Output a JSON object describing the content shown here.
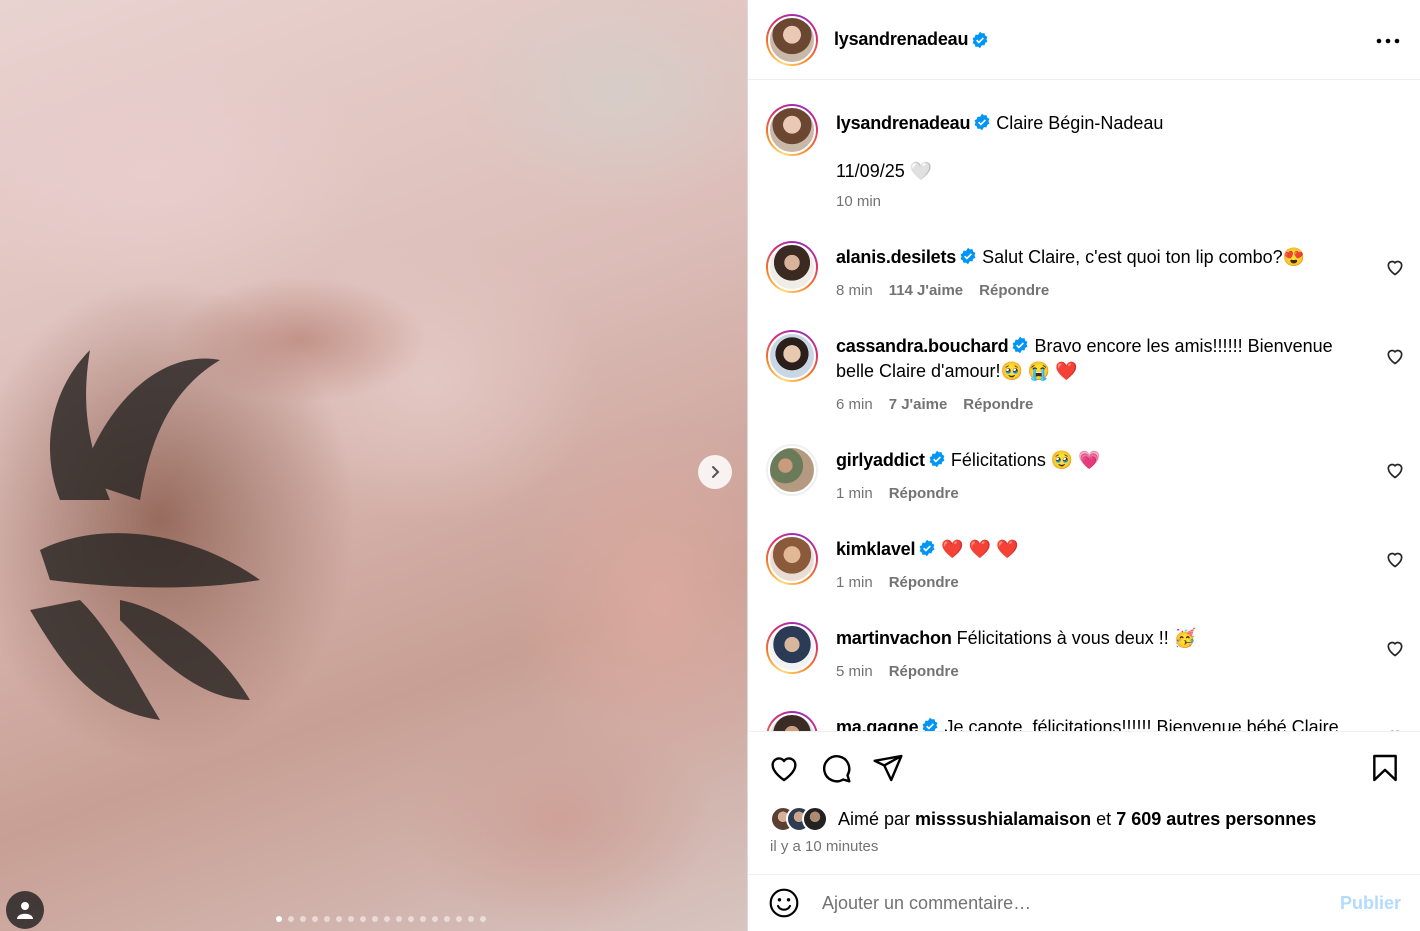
{
  "post": {
    "author": "lysandrenadeau",
    "caption_text": "Claire Bégin-Nadeau",
    "caption_date": "11/09/25 🤍",
    "caption_time": "10 min",
    "carousel_dot_count": 18,
    "carousel_active_index": 0
  },
  "comments": [
    {
      "user": "alanis.desilets",
      "verified": true,
      "text": "Salut Claire, c'est quoi ton lip combo?😍",
      "time": "8 min",
      "likes": "114 J'aime",
      "reply": "Répondre"
    },
    {
      "user": "cassandra.bouchard",
      "verified": true,
      "text": "Bravo encore les amis!!!!!! Bienvenue belle Claire d'amour!🥹 😭 ❤️",
      "time": "6 min",
      "likes": "7 J'aime",
      "reply": "Répondre"
    },
    {
      "user": "girlyaddict",
      "verified": true,
      "text": "Félicitations 🥹 💗",
      "time": "1 min",
      "likes": "",
      "reply": "Répondre"
    },
    {
      "user": "kimklavel",
      "verified": true,
      "text": "❤️ ❤️ ❤️",
      "time": "1 min",
      "likes": "",
      "reply": "Répondre"
    },
    {
      "user": "martinvachon",
      "verified": false,
      "text": "Félicitations à vous deux !! 🥳",
      "time": "5 min",
      "likes": "",
      "reply": "Répondre"
    },
    {
      "user": "ma.gagne",
      "verified": true,
      "text": "Je capote, félicitations!!!!!! Bienvenue bébé Claire",
      "time": "",
      "likes": "",
      "reply": ""
    }
  ],
  "engagement": {
    "liked_by_prefix": "Aimé par",
    "liked_by_user": "misssushialamaison",
    "liked_by_joiner": "et",
    "liked_by_others": "7 609 autres personnes",
    "posted_ago": "il y a 10 minutes"
  },
  "composer": {
    "placeholder": "Ajouter un commentaire…",
    "publish_label": "Publier"
  },
  "colors": {
    "verified": "#0095f6",
    "publish_disabled": "#b3dbff",
    "secondary_text": "#737373"
  },
  "icons": [
    "more-icon",
    "verified-icon",
    "heart-icon",
    "comment-icon",
    "share-icon",
    "bookmark-icon",
    "emoji-icon",
    "chevron-right-icon",
    "user-tag-icon"
  ]
}
